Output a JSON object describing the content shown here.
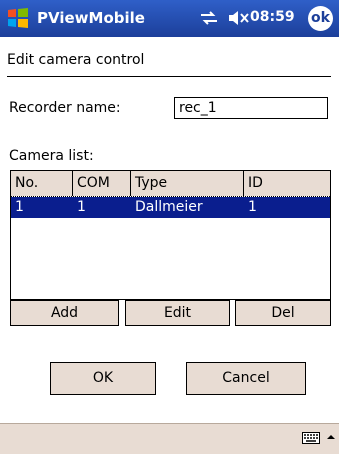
{
  "titlebar": {
    "app_name": "PViewMobile",
    "time": "08:59",
    "ok_label": "ok",
    "icons": [
      "windows-start-icon",
      "connectivity-icon",
      "volume-muted-icon"
    ],
    "color": "#1c3f9a"
  },
  "dialog": {
    "title": "Edit camera control"
  },
  "recorder": {
    "label": "Recorder name:",
    "value": "rec_1"
  },
  "camera_list": {
    "label": "Camera list:",
    "columns": [
      "No.",
      "COM",
      "Type",
      "ID"
    ],
    "rows": [
      {
        "no": "1",
        "com": "1",
        "type": "Dallmeier",
        "id": "1"
      }
    ],
    "selected_row_color": "#0a1e8e"
  },
  "list_buttons": {
    "add": "Add",
    "edit": "Edit",
    "del": "Del"
  },
  "dialog_buttons": {
    "ok": "OK",
    "cancel": "Cancel"
  },
  "menubar": {
    "icons": [
      "keyboard-icon",
      "input-up-arrow-icon"
    ]
  }
}
